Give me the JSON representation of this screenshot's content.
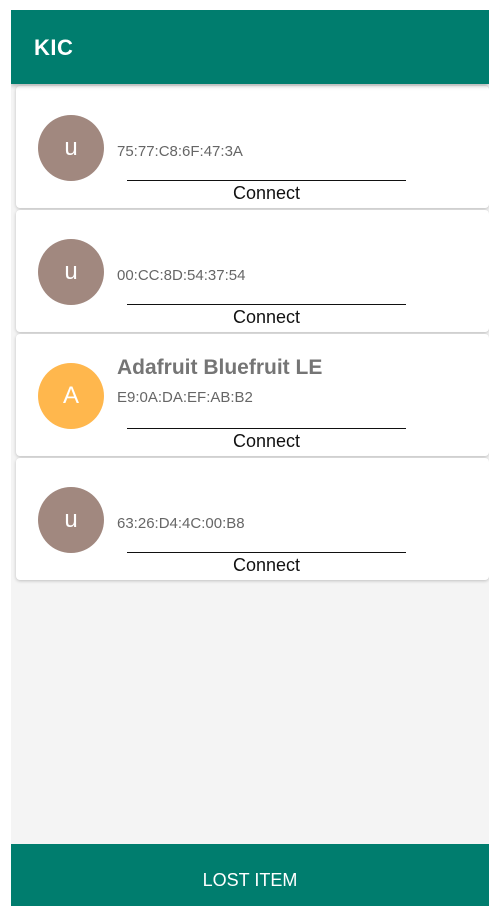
{
  "app_bar": {
    "title": "KIC",
    "color": "#007d6e"
  },
  "devices": [
    {
      "avatar_letter": "u",
      "avatar_color": "#a1887f",
      "name": "",
      "address": "75:77:C8:6F:47:3A",
      "action_label": "Connect"
    },
    {
      "avatar_letter": "u",
      "avatar_color": "#a1887f",
      "name": "",
      "address": "00:CC:8D:54:37:54",
      "action_label": "Connect"
    },
    {
      "avatar_letter": "A",
      "avatar_color": "#ffb74d",
      "name": "Adafruit Bluefruit LE",
      "address": "E9:0A:DA:EF:AB:B2",
      "action_label": "Connect"
    },
    {
      "avatar_letter": "u",
      "avatar_color": "#a1887f",
      "name": "",
      "address": "63:26:D4:4C:00:B8",
      "action_label": "Connect"
    }
  ],
  "bottom_bar": {
    "label": "LOST ITEM",
    "color": "#007d6e"
  }
}
